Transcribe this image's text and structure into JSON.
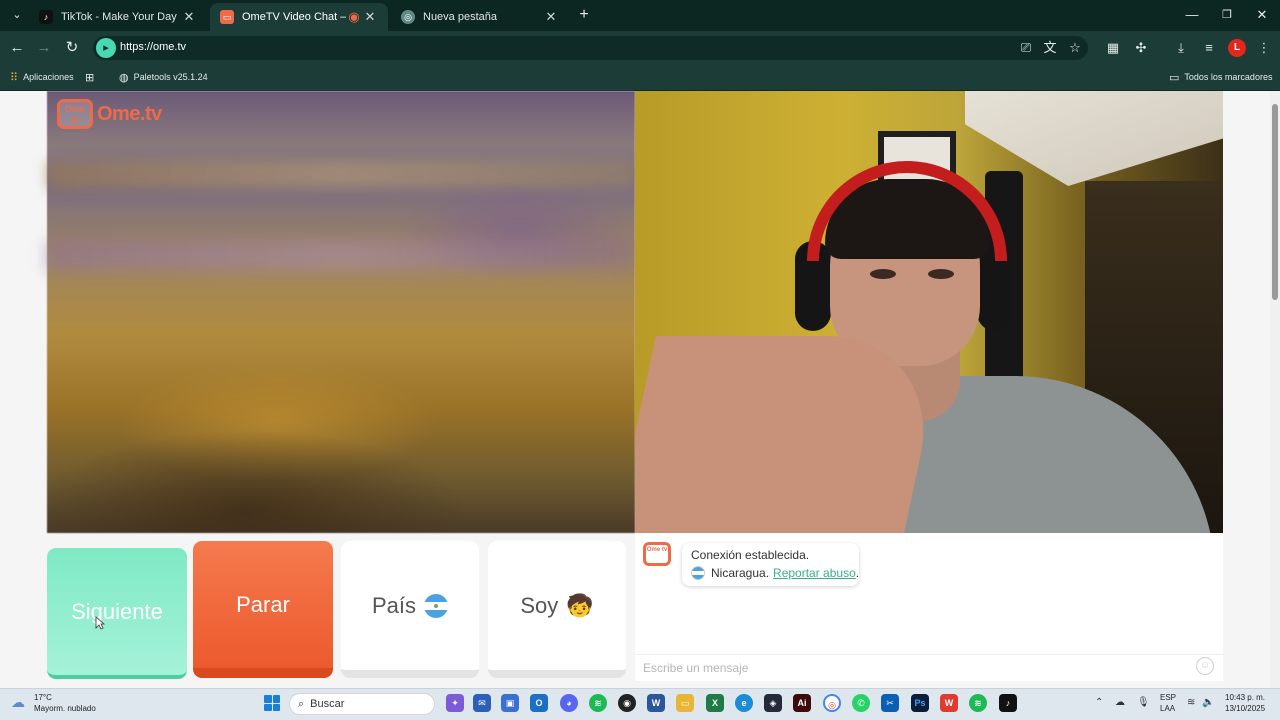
{
  "browser": {
    "tabs": [
      {
        "label": "TikTok - Make Your Day",
        "favicon": "tiktok-icon"
      },
      {
        "label": "OmeTV Video Chat — Omegl",
        "favicon": "ometv-icon",
        "active": true
      },
      {
        "label": "Nueva pestaña",
        "favicon": "chrome-icon"
      }
    ],
    "url": "https://ome.tv",
    "profile_initial": "L",
    "bookmarks": {
      "apps_label": "Aplicaciones",
      "paletools_label": "Paletools v25.1.24",
      "all_bookmarks_label": "Todos los marcadores"
    }
  },
  "ometv": {
    "logo_small": "Ome tv",
    "logo_word": "Ome.tv",
    "buttons": {
      "next": "Siguiente",
      "stop": "Parar",
      "country": "País",
      "soy": "Soy"
    },
    "chat": {
      "status": "Conexión establecida.",
      "country": "Nicaragua.",
      "report_link": "Reportar abuso",
      "report_suffix": ".",
      "placeholder": "Escribe un mensaje"
    }
  },
  "taskbar": {
    "temperature": "17°C",
    "weather": "Mayorm. nublado",
    "search_label": "Buscar",
    "lang_top": "ESP",
    "lang_bottom": "LAA",
    "time": "10:43 p. m.",
    "date": "13/10/2025"
  },
  "colors": {
    "accent_green": "#7ee9c4",
    "accent_orange": "#f06a4a",
    "browser_frame": "#1c3c37"
  }
}
